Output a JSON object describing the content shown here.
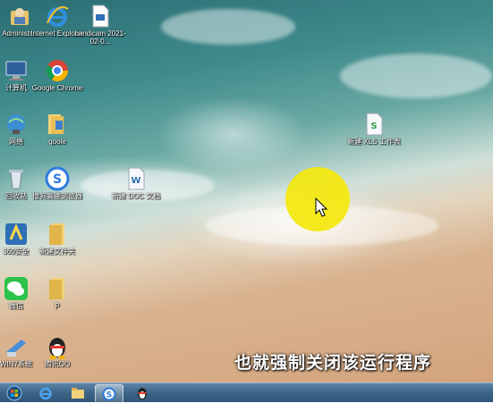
{
  "desktop": {
    "icons": [
      {
        "label": "Administr...",
        "icon": "user-folder-icon"
      },
      {
        "label": "Internet Explorer",
        "icon": "internet-explorer-icon"
      },
      {
        "label": "bandicam 2021-02-0...",
        "icon": "document-icon"
      },
      {
        "label": "计算机",
        "icon": "computer-icon"
      },
      {
        "label": "Google Chrome",
        "icon": "chrome-icon"
      },
      {
        "label": "网络",
        "icon": "network-icon"
      },
      {
        "label": "goole",
        "icon": "folder-icon"
      },
      {
        "label": "回收站",
        "icon": "recycle-bin-icon"
      },
      {
        "label": "搜狗高速浏览器",
        "icon": "sogou-browser-icon"
      },
      {
        "label": "新建 DOC 文档",
        "icon": "word-document-icon"
      },
      {
        "label": "新建 XLS 工作表",
        "icon": "spreadsheet-icon"
      },
      {
        "label": "360安全",
        "icon": "shield-app-icon"
      },
      {
        "label": "新建文件夹",
        "icon": "folder-icon"
      },
      {
        "label": "微信",
        "icon": "wechat-icon"
      },
      {
        "label": "P",
        "icon": "folder-icon"
      },
      {
        "label": "WIN7系统",
        "icon": "win7-setup-icon"
      },
      {
        "label": "腾讯QQ",
        "icon": "qq-penguin-icon"
      }
    ]
  },
  "subtitle": "也就强制关闭该运行程序",
  "taskbar": {
    "items": [
      {
        "icon": "windows-start-icon"
      },
      {
        "icon": "internet-explorer-icon"
      },
      {
        "icon": "file-explorer-icon"
      },
      {
        "icon": "sogou-browser-icon"
      },
      {
        "icon": "qq-penguin-icon"
      }
    ]
  },
  "colors": {
    "highlight": "#f4e80c",
    "taskbar": "#3d6588"
  }
}
